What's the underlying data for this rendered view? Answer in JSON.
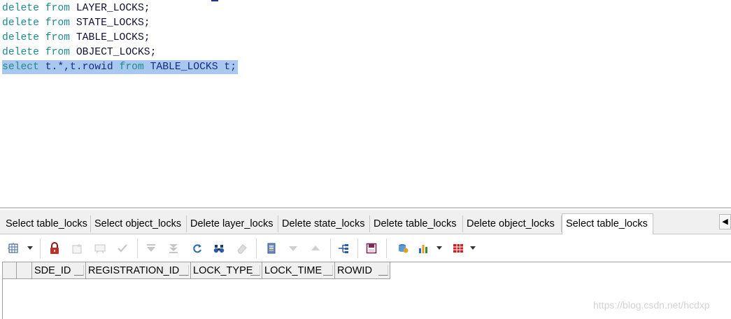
{
  "editor": {
    "lines": [
      {
        "kw1": "delete",
        "kw2": "from",
        "table": "LAYER_LOCKS;"
      },
      {
        "kw1": "delete",
        "kw2": "from",
        "table": "STATE_LOCKS;"
      },
      {
        "kw1": "delete",
        "kw2": "from",
        "table": "TABLE_LOCKS;"
      },
      {
        "kw1": "delete",
        "kw2": "from",
        "table": "OBJECT_LOCKS;"
      }
    ],
    "selected_line": {
      "kw1": "select",
      "cols": "t.*,t.rowid",
      "kw2": "from",
      "table": "TABLE_LOCKS t;"
    }
  },
  "tabs": [
    {
      "label": "Select table_locks"
    },
    {
      "label": "Select object_locks"
    },
    {
      "label": "Delete layer_locks"
    },
    {
      "label": "Delete state_locks"
    },
    {
      "label": "Delete table_locks"
    },
    {
      "label": "Delete object_locks"
    },
    {
      "label": "Select table_locks",
      "active": true
    }
  ],
  "tab_scroll_icon": "chevron-left-icon",
  "toolbar_icons": [
    "select-grid-icon",
    "lock-icon",
    "insert-record-icon",
    "delete-record-icon",
    "post-changes-icon",
    "fetch-next-icon",
    "fetch-last-icon",
    "refresh-icon",
    "find-icon",
    "clear-icon",
    "query-by-example-icon",
    "previous-query-icon",
    "next-query-icon",
    "export-icon",
    "save-icon",
    "database-icon",
    "chart-icon",
    "table-icon"
  ],
  "grid": {
    "columns": [
      "SDE_ID",
      "REGISTRATION_ID",
      "LOCK_TYPE",
      "LOCK_TIME",
      "ROWID"
    ]
  },
  "watermark": "https://blog.csdn.net/hcdxp",
  "colors": {
    "keyword": "#1d8a8a",
    "selection": "#a9c8ef",
    "lock": "#c0302a",
    "save": "#7a2a5a",
    "table_red": "#c82020"
  }
}
